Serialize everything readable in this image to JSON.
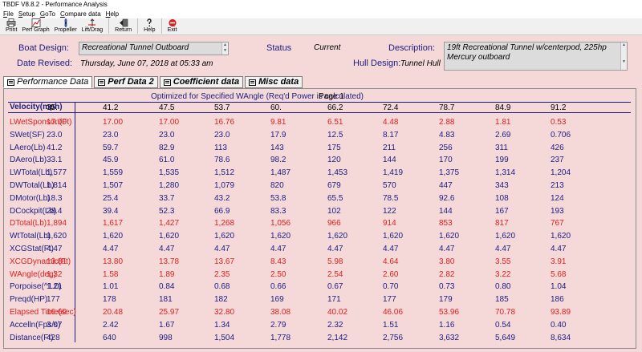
{
  "window": {
    "title": "TBDF V8.8.2 - Performance Analysis"
  },
  "menu": [
    {
      "label": "File",
      "u": "F",
      "rest": "ile"
    },
    {
      "label": "Setup",
      "u": "S",
      "rest": "etup"
    },
    {
      "label": "GoTo",
      "u": "G",
      "rest": "oTo"
    },
    {
      "label": "Compare data",
      "u": "C",
      "rest": "ompare data"
    },
    {
      "label": "Help",
      "u": "H",
      "rest": "elp"
    }
  ],
  "toolbar": {
    "print": "Print",
    "perf_graph": "Perf Graph",
    "propeller": "Propeller",
    "lift_drag": "Lift/Drag",
    "return": "Return",
    "help": "Help",
    "exit": "Exit"
  },
  "header": {
    "boat_design_label": "Boat Design:",
    "boat_design_value": "Recreational Tunnel Outboard",
    "date_revised_label": "Date Revised:",
    "date_revised_value": "Thursday, June 07, 2018 at 05:33 am",
    "status_label": "Status",
    "status_value": "Current",
    "description_label": "Description:",
    "description_value": "19ft Recreational Tunnel w/centerpod, 225hp Mercury outboard",
    "hull_design_label": "Hull Design:",
    "hull_design_value": "Tunnel Hull"
  },
  "tabs": [
    {
      "label": "Performance Data",
      "active": true
    },
    {
      "label": "Perf Data 2",
      "active": false
    },
    {
      "label": "Coefficient data",
      "active": false
    },
    {
      "label": "Misc data",
      "active": false
    }
  ],
  "table": {
    "optimized_note": "Optimized for Specified WAngle (Req'd Power is calculated)",
    "page_label": "Page 1",
    "velocity_label": "Velocity(mph)",
    "velocities": [
      "35.",
      "41.2",
      "47.5",
      "53.7",
      "60.",
      "66.2",
      "72.4",
      "78.7",
      "84.9",
      "91.2"
    ],
    "rows": [
      {
        "label": "LWetSponson(Ft)",
        "color": "red",
        "values": [
          "17.00",
          "17.00",
          "17.00",
          "16.76",
          "9.81",
          "6.51",
          "4.48",
          "2.88",
          "1.81",
          "0.53"
        ]
      },
      {
        "label": "SWet(SF)",
        "color": "blue",
        "values": [
          "23.0",
          "23.0",
          "23.0",
          "23.0",
          "17.9",
          "12.5",
          "8.17",
          "4.83",
          "2.69",
          "0.706"
        ]
      },
      {
        "label": "LAero(Lb)",
        "color": "blue",
        "values": [
          "41.2",
          "59.7",
          "82.9",
          "113",
          "143",
          "175",
          "211",
          "256",
          "311",
          "426"
        ]
      },
      {
        "label": "DAero(Lb)",
        "color": "blue",
        "values": [
          "33.1",
          "45.9",
          "61.0",
          "78.6",
          "98.2",
          "120",
          "144",
          "170",
          "199",
          "237"
        ]
      },
      {
        "label": "LWTotal(Lb)",
        "color": "blue",
        "values": [
          "1,577",
          "1,559",
          "1,535",
          "1,512",
          "1,487",
          "1,453",
          "1,419",
          "1,375",
          "1,314",
          "1,204"
        ]
      },
      {
        "label": "DWTotal(Lb)",
        "color": "blue",
        "values": [
          "1,814",
          "1,507",
          "1,280",
          "1,079",
          "820",
          "679",
          "570",
          "447",
          "343",
          "213"
        ]
      },
      {
        "label": "DMotor(Lb)",
        "color": "blue",
        "values": [
          "18.3",
          "25.4",
          "33.7",
          "43.2",
          "53.8",
          "65.5",
          "78.5",
          "92.6",
          "108",
          "124"
        ]
      },
      {
        "label": "DCockpit(Lb)",
        "color": "blue",
        "values": [
          "28.4",
          "39.4",
          "52.3",
          "66.9",
          "83.3",
          "102",
          "122",
          "144",
          "167",
          "193"
        ]
      },
      {
        "label": "DTotal(Lb)",
        "color": "red",
        "values": [
          "1,894",
          "1,617",
          "1,427",
          "1,268",
          "1,056",
          "966",
          "914",
          "853",
          "817",
          "767"
        ]
      },
      {
        "label": "WtTotal(Lb)",
        "color": "blue",
        "values": [
          "1,620",
          "1,620",
          "1,620",
          "1,620",
          "1,620",
          "1,620",
          "1,620",
          "1,620",
          "1,620",
          "1,620"
        ]
      },
      {
        "label": "XCGStat(Ft)",
        "color": "blue",
        "values": [
          "4.47",
          "4.47",
          "4.47",
          "4.47",
          "4.47",
          "4.47",
          "4.47",
          "4.47",
          "4.47",
          "4.47"
        ]
      },
      {
        "label": "XCGDynamic(Ft)",
        "color": "red",
        "values": [
          "13.81",
          "13.80",
          "13.78",
          "13.67",
          "8.43",
          "5.98",
          "4.64",
          "3.80",
          "3.55",
          "3.91"
        ]
      },
      {
        "label": "WAngle(deg)",
        "color": "red",
        "values": [
          "1.32",
          "1.58",
          "1.89",
          "2.35",
          "2.50",
          "2.54",
          "2.60",
          "2.82",
          "3.22",
          "5.68"
        ]
      },
      {
        "label": "Porpoise(^1.0)",
        "color": "blue",
        "values": [
          "1.21",
          "1.01",
          "0.84",
          "0.68",
          "0.66",
          "0.67",
          "0.70",
          "0.73",
          "0.80",
          "1.04"
        ]
      },
      {
        "label": "Preqd(HP)",
        "color": "blue",
        "values": [
          "177",
          "178",
          "181",
          "182",
          "169",
          "171",
          "177",
          "179",
          "185",
          "186"
        ]
      },
      {
        "label": "Elapsed Time(sec)",
        "color": "red",
        "values": [
          "16.69",
          "20.48",
          "25.97",
          "32.80",
          "38.08",
          "40.02",
          "46.06",
          "53.96",
          "70.78",
          "93.89"
        ]
      },
      {
        "label": "Accelln(Fps/s)",
        "color": "blue",
        "values": [
          "3.07",
          "2.42",
          "1.67",
          "1.34",
          "2.79",
          "2.32",
          "1.51",
          "1.16",
          "0.54",
          "0.40"
        ]
      },
      {
        "label": "Distance(Ft)",
        "color": "blue",
        "values": [
          "428",
          "640",
          "998",
          "1,504",
          "1,778",
          "2,142",
          "2,756",
          "3,632",
          "5,649",
          "8,634"
        ]
      }
    ]
  },
  "colors": {
    "label_blue": "#1c1c80",
    "highlight_red": "#e02020",
    "panel_bg": "#f5d9d9"
  }
}
